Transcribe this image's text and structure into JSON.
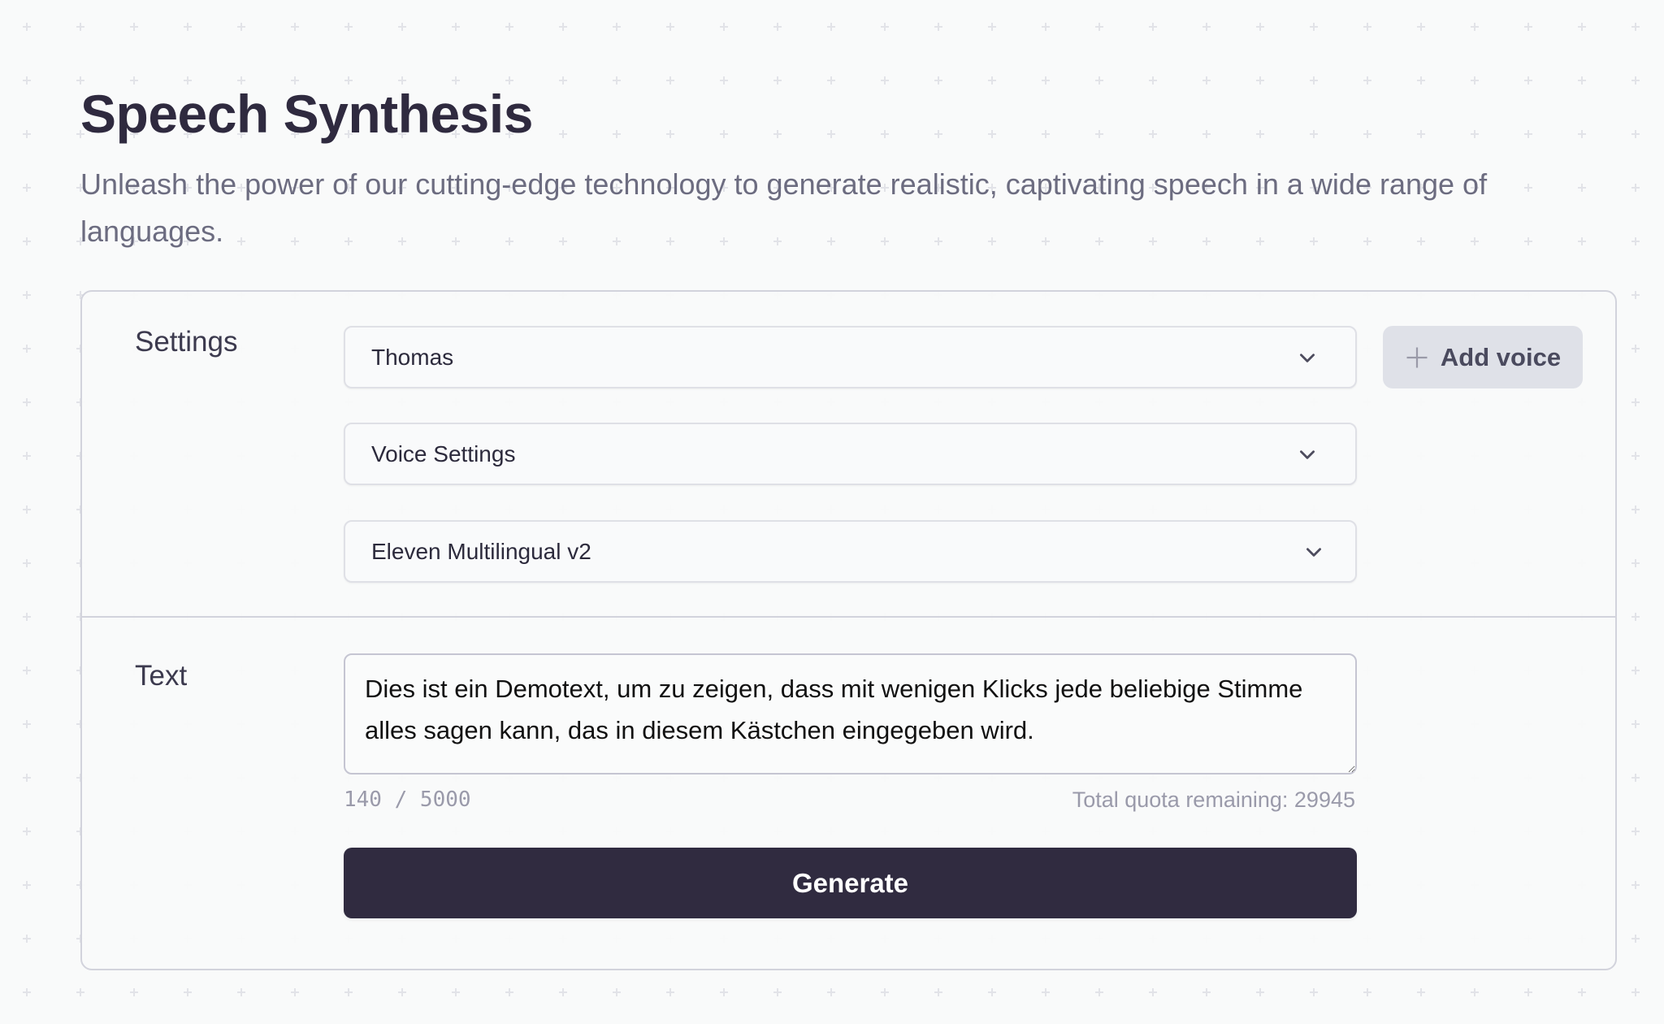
{
  "page": {
    "title": "Speech Synthesis",
    "subtitle": "Unleash the power of our cutting-edge technology to generate realistic, captivating speech in a wide range of languages."
  },
  "settings": {
    "label": "Settings",
    "voice_select": {
      "value": "Thomas",
      "icon": "chevron-down-icon"
    },
    "voice_settings_select": {
      "value": "Voice Settings",
      "icon": "chevron-down-icon"
    },
    "model_select": {
      "value": "Eleven Multilingual v2",
      "icon": "chevron-down-icon"
    },
    "add_voice_button": {
      "label": "Add voice",
      "icon": "plus-icon"
    }
  },
  "text_section": {
    "label": "Text",
    "textarea_value": "Dies ist ein Demotext, um zu zeigen, dass mit wenigen Klicks jede beliebige Stimme alles sagen kann, das in diesem Kästchen eingegeben wird.",
    "char_count": "140 / 5000",
    "quota_label": "Total quota remaining:",
    "quota_value": "29945",
    "generate_button": "Generate"
  },
  "colors": {
    "background": "#f9fafa",
    "title": "#2f2a3f",
    "subtitle": "#6c6c80",
    "primary_button": "#302b40",
    "secondary_button": "#dfe1e8",
    "muted_text": "#9a9aaa",
    "border": "#d2d3dc"
  }
}
